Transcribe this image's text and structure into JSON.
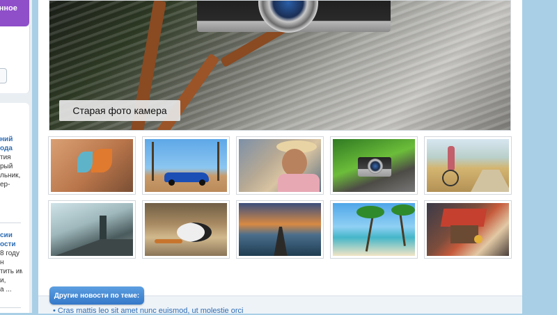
{
  "sidebar": {
    "promo_text": "онное",
    "news": [
      {
        "title": "ний",
        "title2": "ода",
        "lines": [
          "тия",
          "рый",
          "льник,",
          "ер-"
        ]
      },
      {
        "title": "сии",
        "title2": "ости",
        "lines": [
          "8 году",
          "н",
          "тить им",
          "и,",
          "а ..."
        ]
      }
    ]
  },
  "main": {
    "hero_caption": "Старая фото камера",
    "thumbnails": [
      {
        "name": "flower-macro"
      },
      {
        "name": "blue-convertible"
      },
      {
        "name": "woman-hat"
      },
      {
        "name": "camera-on-wood"
      },
      {
        "name": "girl-with-bike"
      },
      {
        "name": "man-on-bridge"
      },
      {
        "name": "dog-with-rope"
      },
      {
        "name": "pier-sunset"
      },
      {
        "name": "tropical-beach"
      },
      {
        "name": "birdhouse"
      }
    ]
  },
  "other_news": {
    "button_label": "Другие новости по теме:",
    "first_link": "• Cras mattis leo sit amet nunc euismod, ut molestie orci"
  },
  "colors": {
    "page_bg": "#a9cfe6",
    "accent_purple": "#8e4fc9",
    "link_blue": "#2e6db3"
  }
}
